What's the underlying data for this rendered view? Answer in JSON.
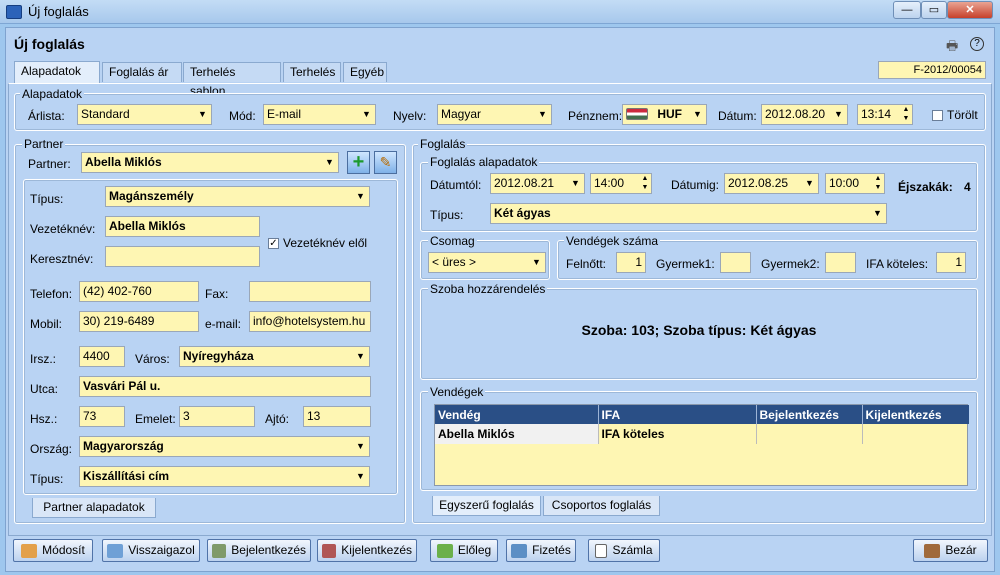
{
  "window": {
    "title": "Új foglalás"
  },
  "header": {
    "title": "Új foglalás",
    "reference": "F-2012/00054"
  },
  "tabs": [
    "Alapadatok",
    "Foglalás ár",
    "Terhelés sablon",
    "Terhelés",
    "Egyéb"
  ],
  "basic": {
    "group": "Alapadatok",
    "price_list_label": "Árlista:",
    "price_list": "Standard",
    "mode_label": "Mód:",
    "mode": "E-mail",
    "lang_label": "Nyelv:",
    "lang": "Magyar",
    "currency_label": "Pénznem:",
    "currency": "HUF",
    "date_label": "Dátum:",
    "date": "2012.08.20",
    "time": "13:14",
    "deleted_label": "Törölt"
  },
  "partner": {
    "group": "Partner",
    "partner_label": "Partner:",
    "partner": "Abella Miklós",
    "type_label": "Típus:",
    "type": "Magánszemély",
    "lastname_label": "Vezetéknév:",
    "lastname": "Abella Miklós",
    "lastname_first_label": "Vezetéknév elől",
    "firstname_label": "Keresztnév:",
    "firstname": "",
    "phone_label": "Telefon:",
    "phone": "(42) 402-760",
    "fax_label": "Fax:",
    "fax": "",
    "mobile_label": "Mobil:",
    "mobile": "30) 219-6489",
    "email_label": "e-mail:",
    "email": "info@hotelsystem.hu",
    "zip_label": "Irsz.:",
    "zip": "4400",
    "city_label": "Város:",
    "city": "Nyíregyháza",
    "street_label": "Utca:",
    "street": "Vasvári Pál u.",
    "hsz_label": "Hsz.:",
    "hsz": "73",
    "floor_label": "Emelet:",
    "floor": "3",
    "door_label": "Ajtó:",
    "door": "13",
    "country_label": "Ország:",
    "country": "Magyarország",
    "addrtype_label": "Típus:",
    "addrtype": "Kiszállítási cím",
    "tab": "Partner alapadatok"
  },
  "booking": {
    "group": "Foglalás",
    "basics_group": "Foglalás alapadatok",
    "from_label": "Dátumtól:",
    "from_date": "2012.08.21",
    "from_time": "14:00",
    "to_label": "Dátumig:",
    "to_date": "2012.08.25",
    "to_time": "10:00",
    "nights_label": "Éjszakák:",
    "nights": "4",
    "type_label": "Típus:",
    "type": "Két ágyas",
    "package_group": "Csomag",
    "package": "< üres >",
    "guests_count_group": "Vendégek száma",
    "adult_label": "Felnőtt:",
    "adult": "1",
    "child1_label": "Gyermek1:",
    "child1": "",
    "child2_label": "Gyermek2:",
    "child2": "",
    "tax_label": "IFA köteles:",
    "tax": "1",
    "room_group": "Szoba hozzárendelés",
    "room_text": "Szoba: 103; Szoba típus: Két ágyas",
    "guests_group": "Vendégek",
    "columns": [
      "Vendég",
      "IFA",
      "Bejelentkezés",
      "Kijelentkezés"
    ],
    "rows": [
      [
        "Abella Miklós",
        "IFA köteles",
        "",
        ""
      ]
    ],
    "tabs": [
      "Egyszerű foglalás",
      "Csoportos foglalás"
    ]
  },
  "toolbar": {
    "modify": "Módosít",
    "confirm": "Visszaigazol",
    "checkin": "Bejelentkezés",
    "checkout": "Kijelentkezés",
    "deposit": "Előleg",
    "payment": "Fizetés",
    "invoice": "Számla",
    "close": "Bezár"
  },
  "colors": {
    "accent": "#2c63b9",
    "field": "#fef6b3",
    "background": "#b9d3f3"
  }
}
